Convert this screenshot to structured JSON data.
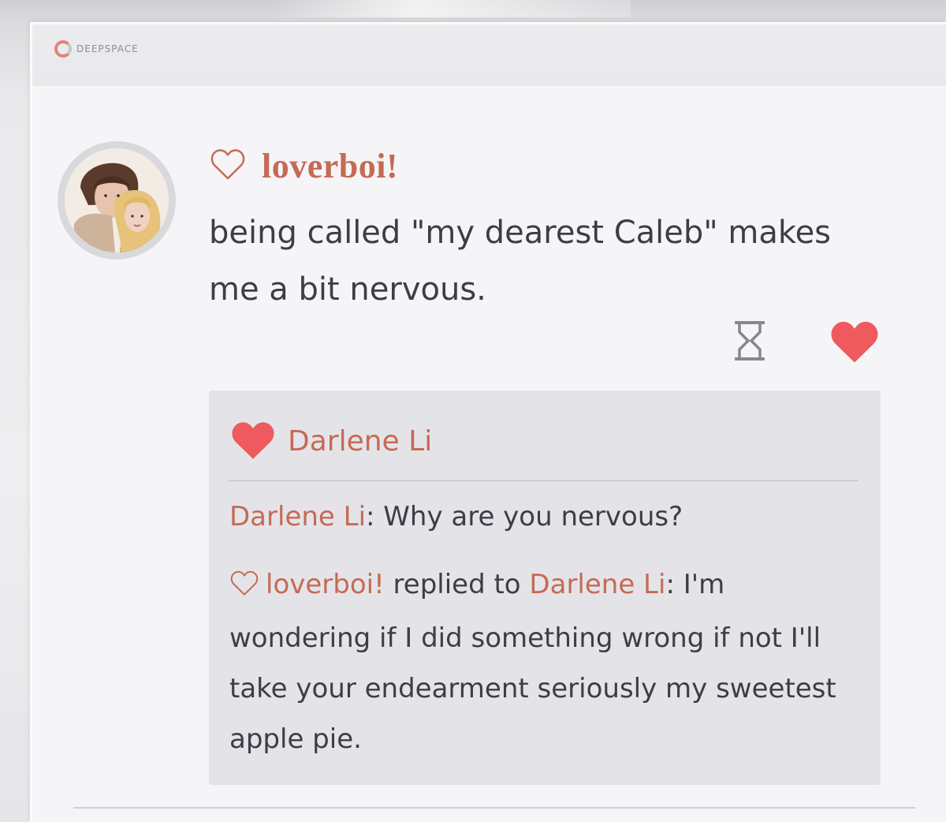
{
  "brand": {
    "logo_text": "DEEPSPACE"
  },
  "post": {
    "author": "loverboi!",
    "text": "being called \"my dearest Caleb\" makes me a bit nervous.",
    "author_icon": "outline-heart-icon",
    "actions": {
      "hourglass_icon": "hourglass-icon",
      "like_icon": "filled-heart-icon"
    }
  },
  "comments": {
    "liker": "Darlene Li",
    "items": [
      {
        "author": "Darlene Li",
        "separator": ": ",
        "text": "Why are you nervous?"
      }
    ],
    "reply": {
      "author": "loverboi!",
      "verb": " replied to ",
      "target": "Darlene Li",
      "separator": ": ",
      "text": "I'm wondering if I did something wrong if not I'll take your endearment seriously my sweetest apple pie."
    }
  },
  "colors": {
    "accent": "#c66a55",
    "like_red": "#ee5a5e",
    "text": "#3f3c47",
    "icon_gray": "#8a8592",
    "panel": "#e4e4e8",
    "card": "#f5f5f7"
  }
}
